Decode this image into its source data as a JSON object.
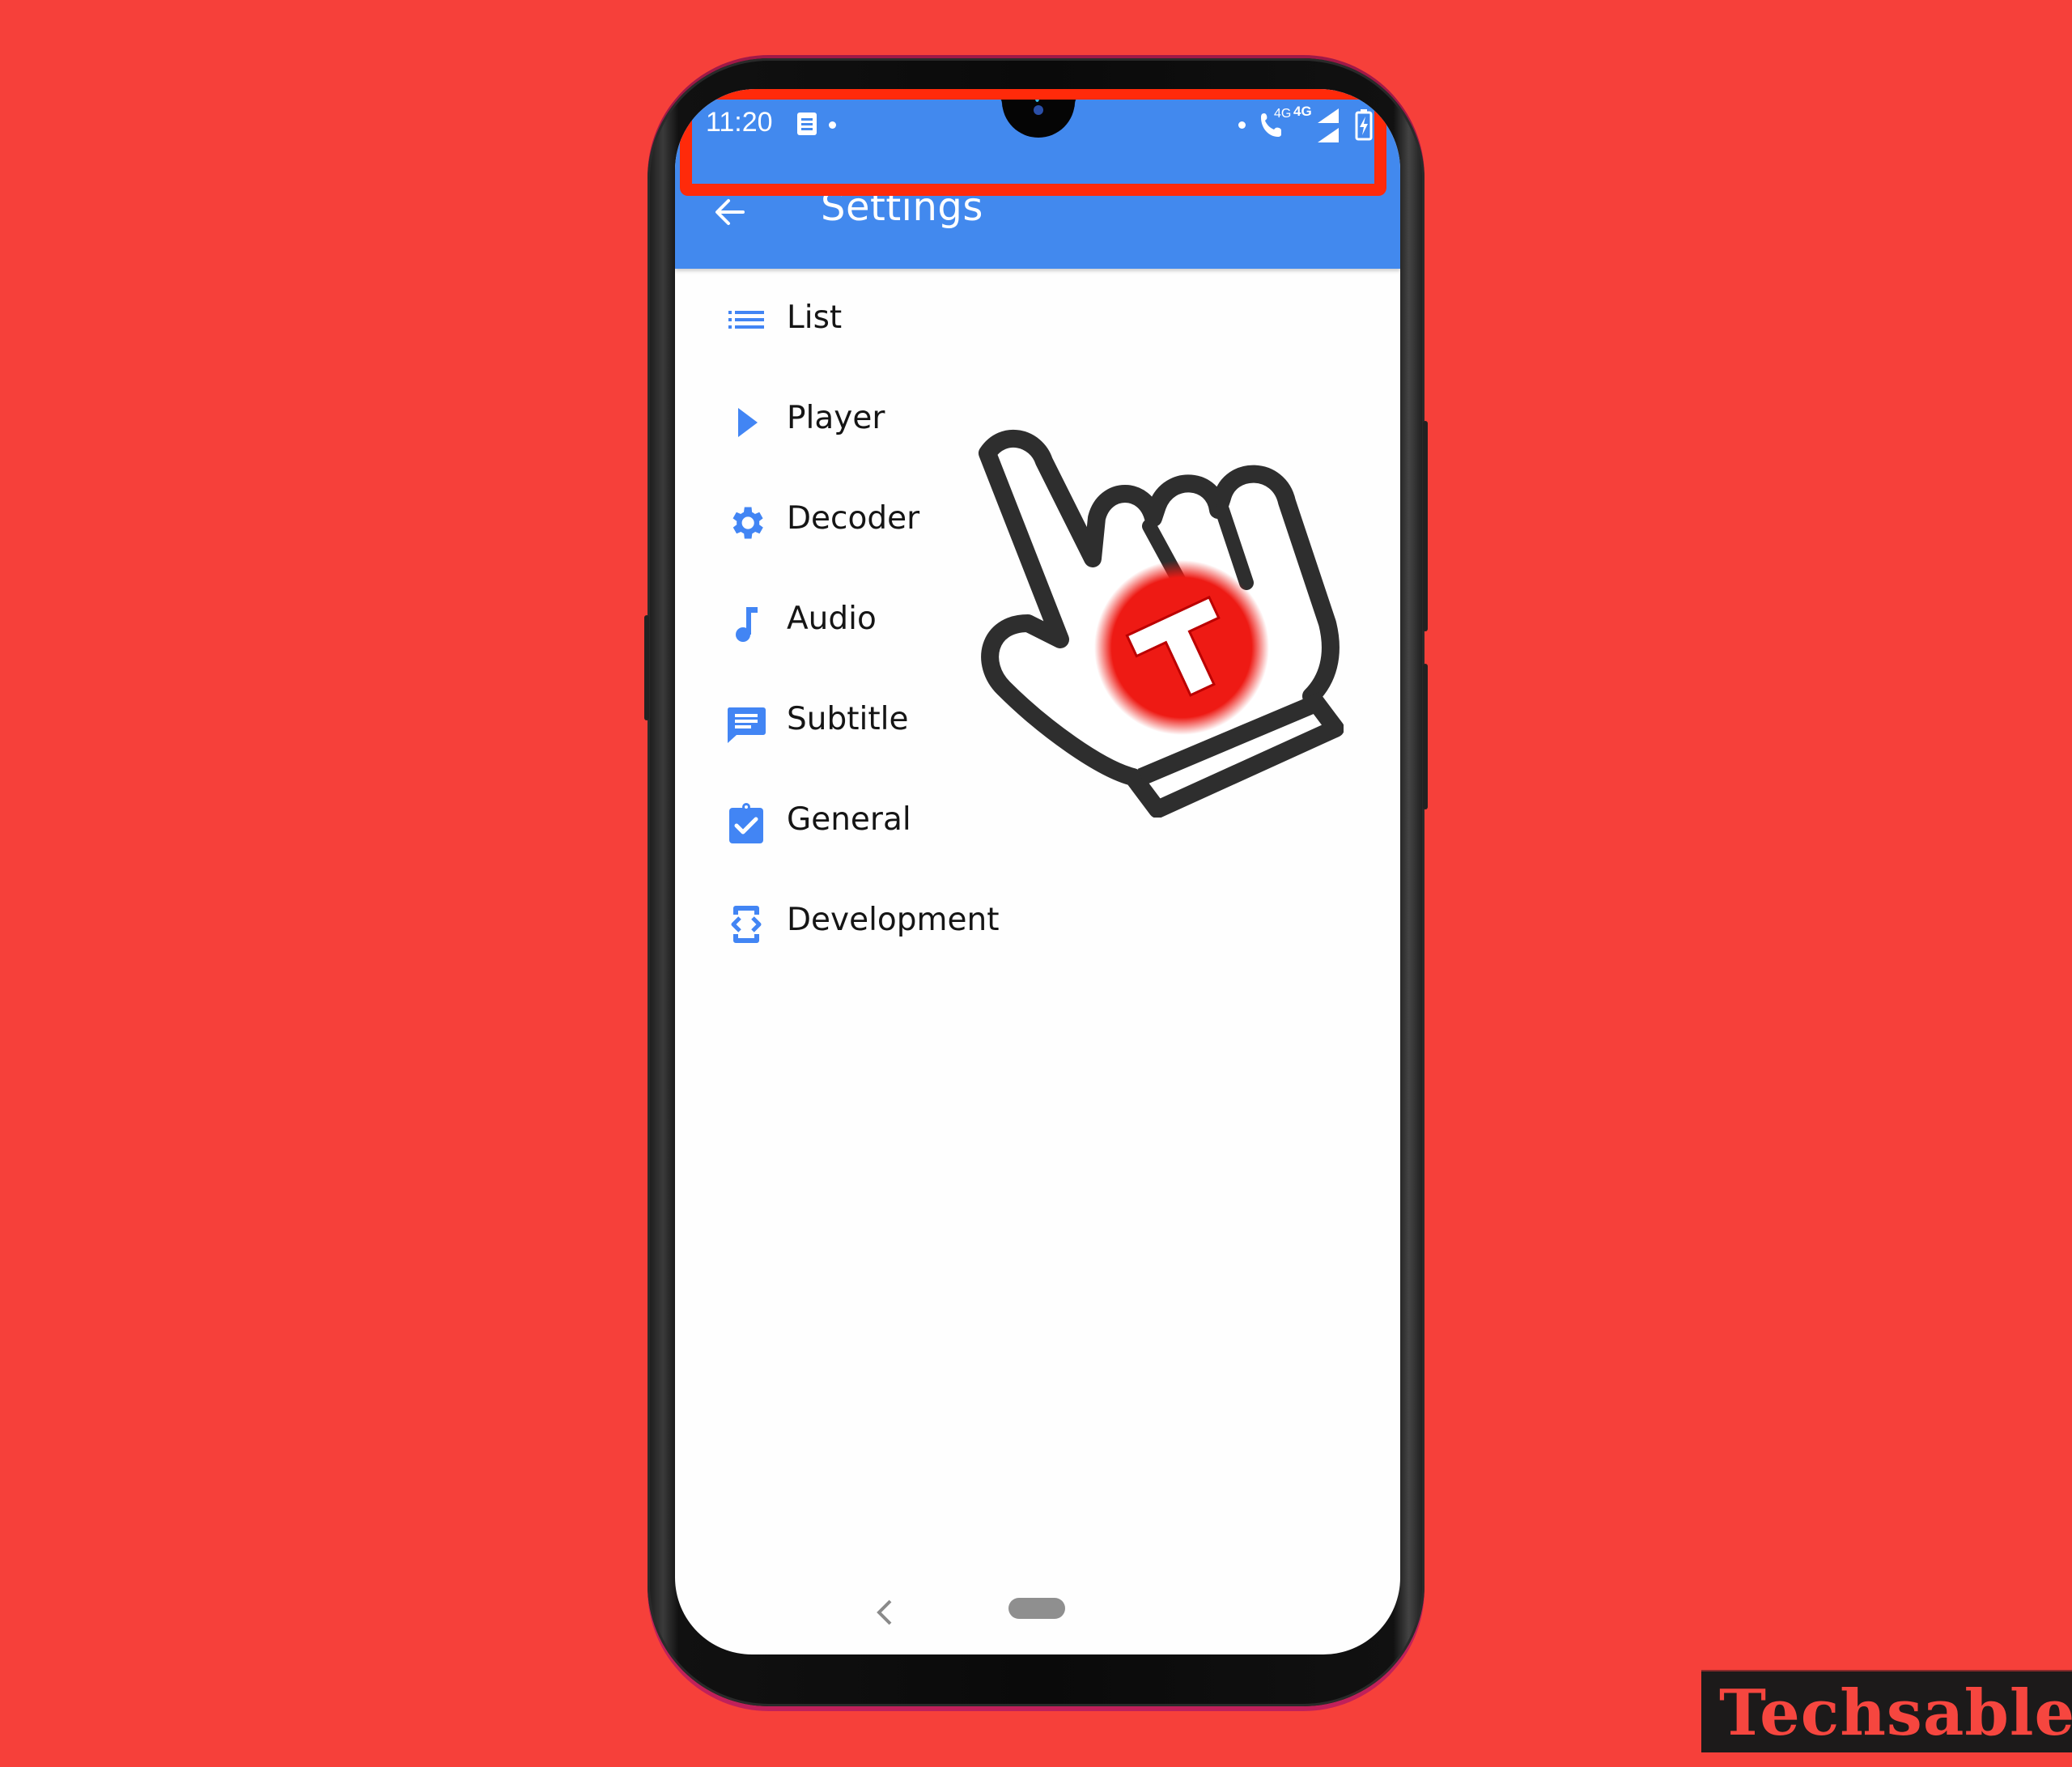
{
  "status_bar": {
    "time": "11:20",
    "left_icons": [
      "notification-doc-icon",
      "dot-icon"
    ],
    "right_icons": [
      "dot-icon",
      "wifi-call-icon",
      "signal-4g-icon",
      "signal-4g-icon",
      "signal-bars-icon",
      "battery-charging-icon"
    ],
    "network_labels": [
      "4G",
      "4G"
    ]
  },
  "app_bar": {
    "title": "Settings",
    "back_icon": "arrow-back-icon"
  },
  "settings_items": [
    {
      "label": "List",
      "icon": "list-icon"
    },
    {
      "label": "Player",
      "icon": "play-icon",
      "highlighted": true
    },
    {
      "label": "Decoder",
      "icon": "gear-icon"
    },
    {
      "label": "Audio",
      "icon": "music-note-icon"
    },
    {
      "label": "Subtitle",
      "icon": "subtitle-message-icon"
    },
    {
      "label": "General",
      "icon": "clipboard-check-icon"
    },
    {
      "label": "Development",
      "icon": "developer-code-icon"
    }
  ],
  "overlay": {
    "pointer": "hand-pointer-icon",
    "logo_letter": "T"
  },
  "nav_bar": {
    "back": "nav-back-icon",
    "home": "home-pill"
  },
  "watermark": {
    "text": "Techsable"
  },
  "colors": {
    "background": "#f6403a",
    "app_bar": "#4289ee",
    "icon_blue": "#4285f4",
    "highlight": "#ff2a0a"
  }
}
